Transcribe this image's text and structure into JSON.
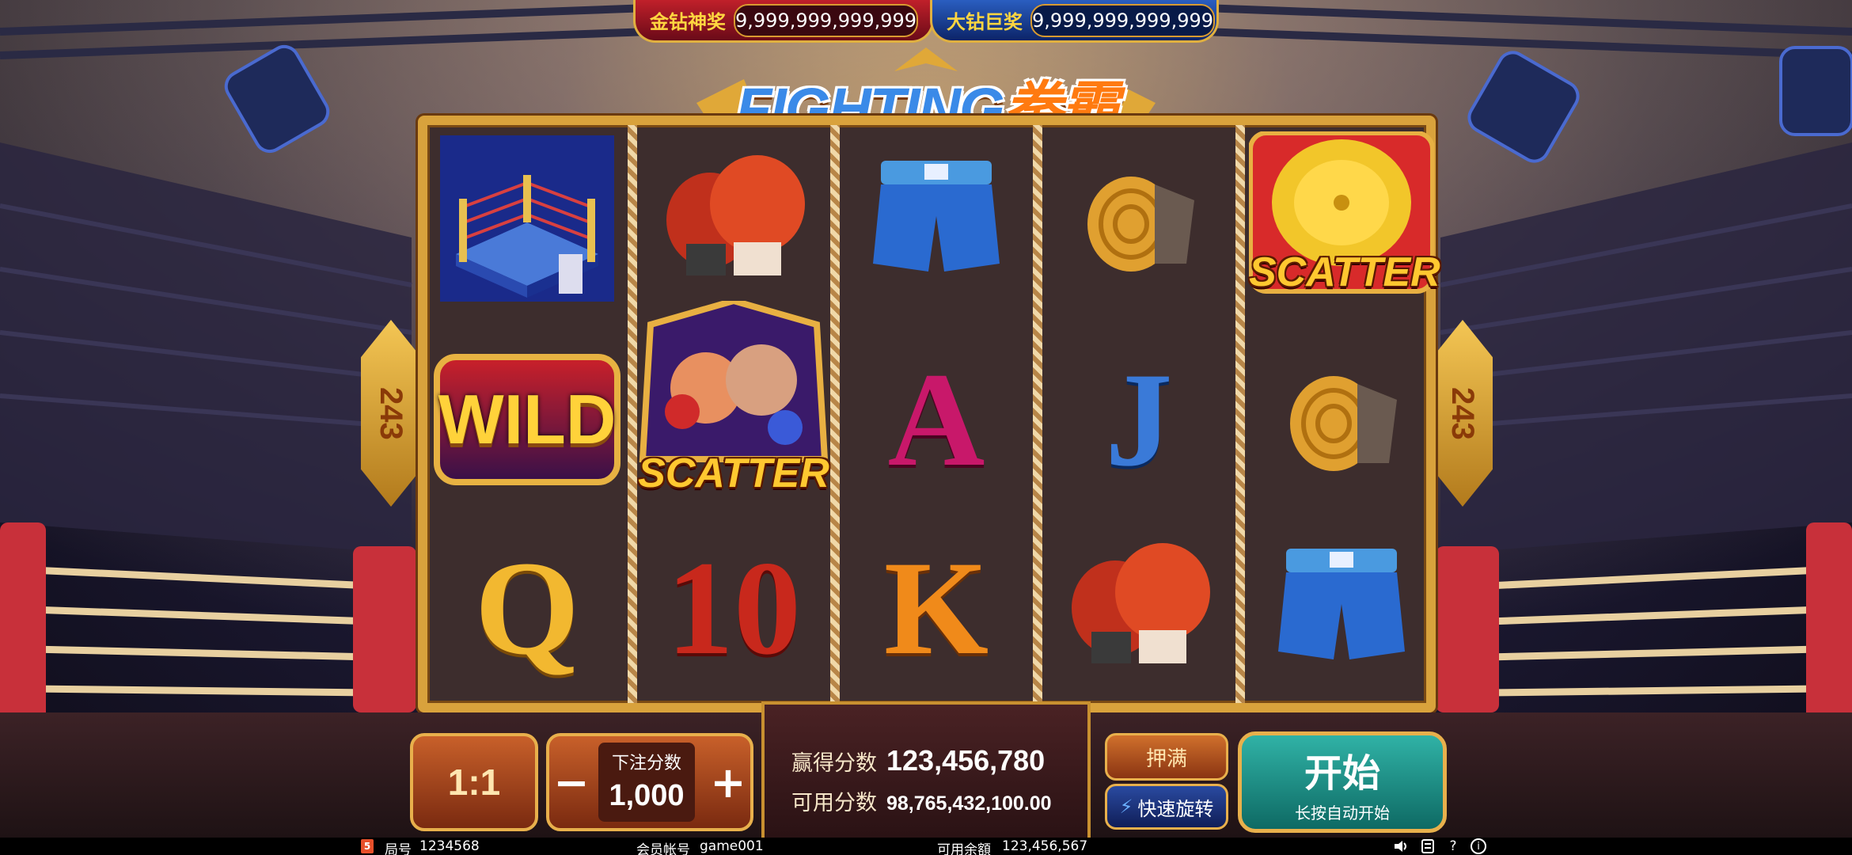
{
  "jackpots": [
    {
      "label": "金钻神奖",
      "value": "9,999,999,999,999",
      "color": "#c0202a"
    },
    {
      "label": "大钻巨奖",
      "value": "9,999,999,999,999",
      "color": "#2a5ec0"
    }
  ],
  "logo": {
    "latin": "FIGHTING",
    "chinese": "拳霸"
  },
  "ways_count": "243",
  "reels": [
    [
      "boxing-ring",
      "wild",
      "Q"
    ],
    [
      "boxing-gloves",
      "scatter-fighters",
      "10"
    ],
    [
      "boxing-shorts",
      "A",
      "K"
    ],
    [
      "hand-wrap",
      "J",
      "boxing-gloves"
    ],
    [
      "scatter-bell",
      "hand-wrap",
      "boxing-shorts"
    ]
  ],
  "symbols": {
    "wild_text": "WILD",
    "scatter_text": "SCATTER",
    "letters": {
      "Q": "Q",
      "10": "10",
      "A": "A",
      "K": "K",
      "J": "J"
    }
  },
  "controls": {
    "ratio_label": "1:1",
    "bet_label": "下注分数",
    "bet_value": "1,000",
    "minus": "−",
    "plus": "+",
    "win_label": "赢得分数",
    "win_value": "123,456,780",
    "avail_label": "可用分数",
    "avail_value": "98,765,432,100.00",
    "max_bet_label": "押满",
    "fast_spin_label": "快速旋转",
    "start_label": "开始",
    "start_sub_label": "长按自动开始"
  },
  "status_bar": {
    "html5_badge": "5",
    "round_label": "局号",
    "round_value": "1234568",
    "account_label": "会员帐号",
    "account_value": "game001",
    "balance_label": "可用余額",
    "balance_value": "123,456,567",
    "help_glyph": "?",
    "info_glyph": "i"
  },
  "colors": {
    "frame_gold": "#d9a23c",
    "start_teal": "#1f8e86",
    "fast_blue": "#2a4aa0"
  }
}
